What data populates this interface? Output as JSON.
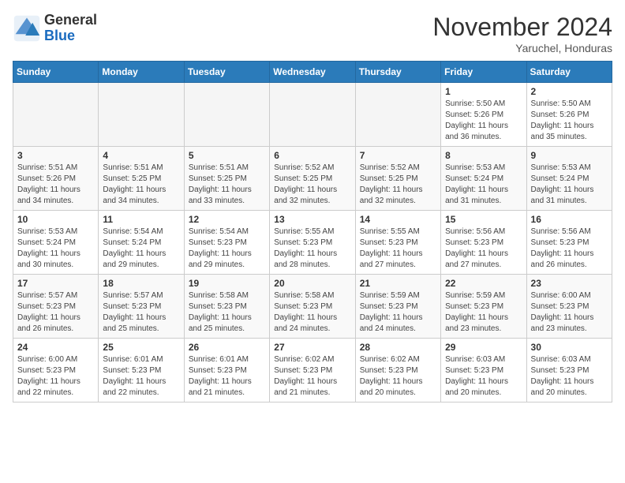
{
  "logo": {
    "general": "General",
    "blue": "Blue"
  },
  "title": "November 2024",
  "location": "Yaruchel, Honduras",
  "days_header": [
    "Sunday",
    "Monday",
    "Tuesday",
    "Wednesday",
    "Thursday",
    "Friday",
    "Saturday"
  ],
  "weeks": [
    [
      {
        "day": "",
        "info": ""
      },
      {
        "day": "",
        "info": ""
      },
      {
        "day": "",
        "info": ""
      },
      {
        "day": "",
        "info": ""
      },
      {
        "day": "",
        "info": ""
      },
      {
        "day": "1",
        "info": "Sunrise: 5:50 AM\nSunset: 5:26 PM\nDaylight: 11 hours\nand 36 minutes."
      },
      {
        "day": "2",
        "info": "Sunrise: 5:50 AM\nSunset: 5:26 PM\nDaylight: 11 hours\nand 35 minutes."
      }
    ],
    [
      {
        "day": "3",
        "info": "Sunrise: 5:51 AM\nSunset: 5:26 PM\nDaylight: 11 hours\nand 34 minutes."
      },
      {
        "day": "4",
        "info": "Sunrise: 5:51 AM\nSunset: 5:25 PM\nDaylight: 11 hours\nand 34 minutes."
      },
      {
        "day": "5",
        "info": "Sunrise: 5:51 AM\nSunset: 5:25 PM\nDaylight: 11 hours\nand 33 minutes."
      },
      {
        "day": "6",
        "info": "Sunrise: 5:52 AM\nSunset: 5:25 PM\nDaylight: 11 hours\nand 32 minutes."
      },
      {
        "day": "7",
        "info": "Sunrise: 5:52 AM\nSunset: 5:25 PM\nDaylight: 11 hours\nand 32 minutes."
      },
      {
        "day": "8",
        "info": "Sunrise: 5:53 AM\nSunset: 5:24 PM\nDaylight: 11 hours\nand 31 minutes."
      },
      {
        "day": "9",
        "info": "Sunrise: 5:53 AM\nSunset: 5:24 PM\nDaylight: 11 hours\nand 31 minutes."
      }
    ],
    [
      {
        "day": "10",
        "info": "Sunrise: 5:53 AM\nSunset: 5:24 PM\nDaylight: 11 hours\nand 30 minutes."
      },
      {
        "day": "11",
        "info": "Sunrise: 5:54 AM\nSunset: 5:24 PM\nDaylight: 11 hours\nand 29 minutes."
      },
      {
        "day": "12",
        "info": "Sunrise: 5:54 AM\nSunset: 5:23 PM\nDaylight: 11 hours\nand 29 minutes."
      },
      {
        "day": "13",
        "info": "Sunrise: 5:55 AM\nSunset: 5:23 PM\nDaylight: 11 hours\nand 28 minutes."
      },
      {
        "day": "14",
        "info": "Sunrise: 5:55 AM\nSunset: 5:23 PM\nDaylight: 11 hours\nand 27 minutes."
      },
      {
        "day": "15",
        "info": "Sunrise: 5:56 AM\nSunset: 5:23 PM\nDaylight: 11 hours\nand 27 minutes."
      },
      {
        "day": "16",
        "info": "Sunrise: 5:56 AM\nSunset: 5:23 PM\nDaylight: 11 hours\nand 26 minutes."
      }
    ],
    [
      {
        "day": "17",
        "info": "Sunrise: 5:57 AM\nSunset: 5:23 PM\nDaylight: 11 hours\nand 26 minutes."
      },
      {
        "day": "18",
        "info": "Sunrise: 5:57 AM\nSunset: 5:23 PM\nDaylight: 11 hours\nand 25 minutes."
      },
      {
        "day": "19",
        "info": "Sunrise: 5:58 AM\nSunset: 5:23 PM\nDaylight: 11 hours\nand 25 minutes."
      },
      {
        "day": "20",
        "info": "Sunrise: 5:58 AM\nSunset: 5:23 PM\nDaylight: 11 hours\nand 24 minutes."
      },
      {
        "day": "21",
        "info": "Sunrise: 5:59 AM\nSunset: 5:23 PM\nDaylight: 11 hours\nand 24 minutes."
      },
      {
        "day": "22",
        "info": "Sunrise: 5:59 AM\nSunset: 5:23 PM\nDaylight: 11 hours\nand 23 minutes."
      },
      {
        "day": "23",
        "info": "Sunrise: 6:00 AM\nSunset: 5:23 PM\nDaylight: 11 hours\nand 23 minutes."
      }
    ],
    [
      {
        "day": "24",
        "info": "Sunrise: 6:00 AM\nSunset: 5:23 PM\nDaylight: 11 hours\nand 22 minutes."
      },
      {
        "day": "25",
        "info": "Sunrise: 6:01 AM\nSunset: 5:23 PM\nDaylight: 11 hours\nand 22 minutes."
      },
      {
        "day": "26",
        "info": "Sunrise: 6:01 AM\nSunset: 5:23 PM\nDaylight: 11 hours\nand 21 minutes."
      },
      {
        "day": "27",
        "info": "Sunrise: 6:02 AM\nSunset: 5:23 PM\nDaylight: 11 hours\nand 21 minutes."
      },
      {
        "day": "28",
        "info": "Sunrise: 6:02 AM\nSunset: 5:23 PM\nDaylight: 11 hours\nand 20 minutes."
      },
      {
        "day": "29",
        "info": "Sunrise: 6:03 AM\nSunset: 5:23 PM\nDaylight: 11 hours\nand 20 minutes."
      },
      {
        "day": "30",
        "info": "Sunrise: 6:03 AM\nSunset: 5:23 PM\nDaylight: 11 hours\nand 20 minutes."
      }
    ]
  ]
}
